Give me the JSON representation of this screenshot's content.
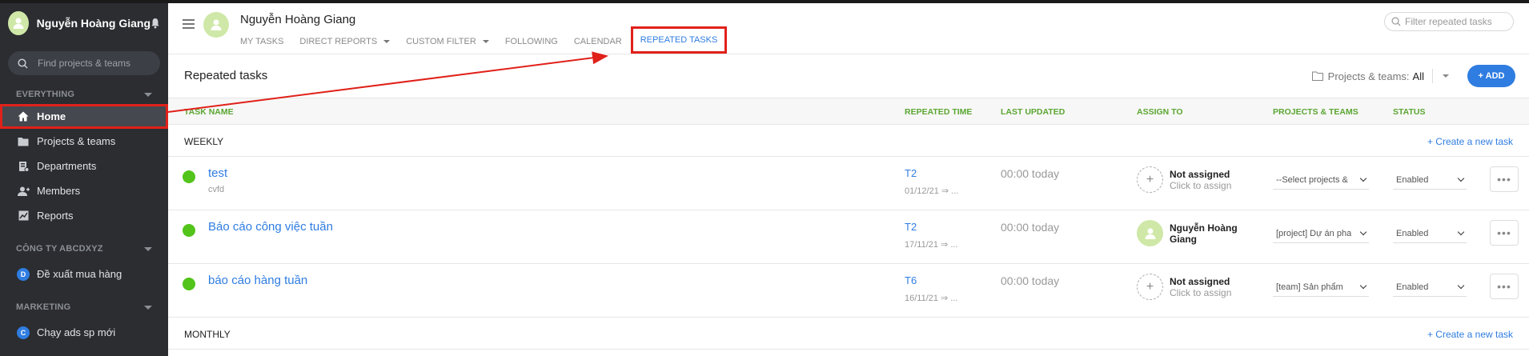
{
  "sidebar": {
    "user_name": "Nguyễn Hoàng Giang",
    "search_placeholder": "Find projects & teams",
    "sections": [
      {
        "title": "EVERYTHING"
      },
      {
        "title": "CÔNG TY ABCDXYZ"
      },
      {
        "title": "MARKETING"
      }
    ],
    "items": [
      {
        "label": "Home",
        "icon": "home-icon"
      },
      {
        "label": "Projects & teams",
        "icon": "folder-icon"
      },
      {
        "label": "Departments",
        "icon": "department-icon"
      },
      {
        "label": "Members",
        "icon": "members-icon"
      },
      {
        "label": "Reports",
        "icon": "reports-icon"
      }
    ],
    "company_items": [
      {
        "badge": "D",
        "label": "Đề xuất mua hàng"
      }
    ],
    "marketing_items": [
      {
        "badge": "C",
        "label": "Chạy ads sp mới"
      }
    ]
  },
  "header": {
    "user_name": "Nguyễn Hoàng Giang",
    "tabs": [
      {
        "label": "MY TASKS"
      },
      {
        "label": "DIRECT REPORTS"
      },
      {
        "label": "CUSTOM FILTER"
      },
      {
        "label": "FOLLOWING"
      },
      {
        "label": "CALENDAR"
      },
      {
        "label": "REPEATED TASKS"
      }
    ],
    "filter_placeholder": "Filter repeated tasks"
  },
  "main": {
    "title": "Repeated tasks",
    "projects_filter_label": "Projects & teams:",
    "projects_filter_value": "All",
    "add_label": "+ ADD"
  },
  "table": {
    "columns": [
      "TASK NAME",
      "REPEATED TIME",
      "LAST UPDATED",
      "ASSIGN TO",
      "PROJECTS & TEAMS",
      "STATUS"
    ],
    "groups": [
      {
        "name": "WEEKLY",
        "create_label": "+ Create a new task"
      },
      {
        "name": "MONTHLY",
        "create_label": "+ Create a new task"
      }
    ],
    "rows": [
      {
        "name": "test",
        "sub": "cvfd",
        "repeat": "T2",
        "repeat_date": "01/12/21 ⇒ ...",
        "updated": "00:00 today",
        "assign_main": "Not assigned",
        "assign_sub": "Click to assign",
        "project": "--Select projects &",
        "status": "Enabled"
      },
      {
        "name": "Báo cáo công việc tuần",
        "sub": "",
        "repeat": "T2",
        "repeat_date": "17/11/21 ⇒ ...",
        "updated": "00:00 today",
        "assign_main": "Nguyễn Hoàng",
        "assign_sub": "Giang",
        "project": "[project] Dự án pha",
        "status": "Enabled"
      },
      {
        "name": "báo cáo hàng tuần",
        "sub": "",
        "repeat": "T6",
        "repeat_date": "16/11/21 ⇒ ...",
        "updated": "00:00 today",
        "assign_main": "Not assigned",
        "assign_sub": "Click to assign",
        "project": "[team] Sản phẩm",
        "status": "Enabled"
      }
    ]
  },
  "colors": {
    "accent": "#2f7de1",
    "sidebar_bg": "#2b2d31",
    "status_green": "#52c41a",
    "header_green": "#5ba632",
    "annotation_red": "#e0211a"
  }
}
